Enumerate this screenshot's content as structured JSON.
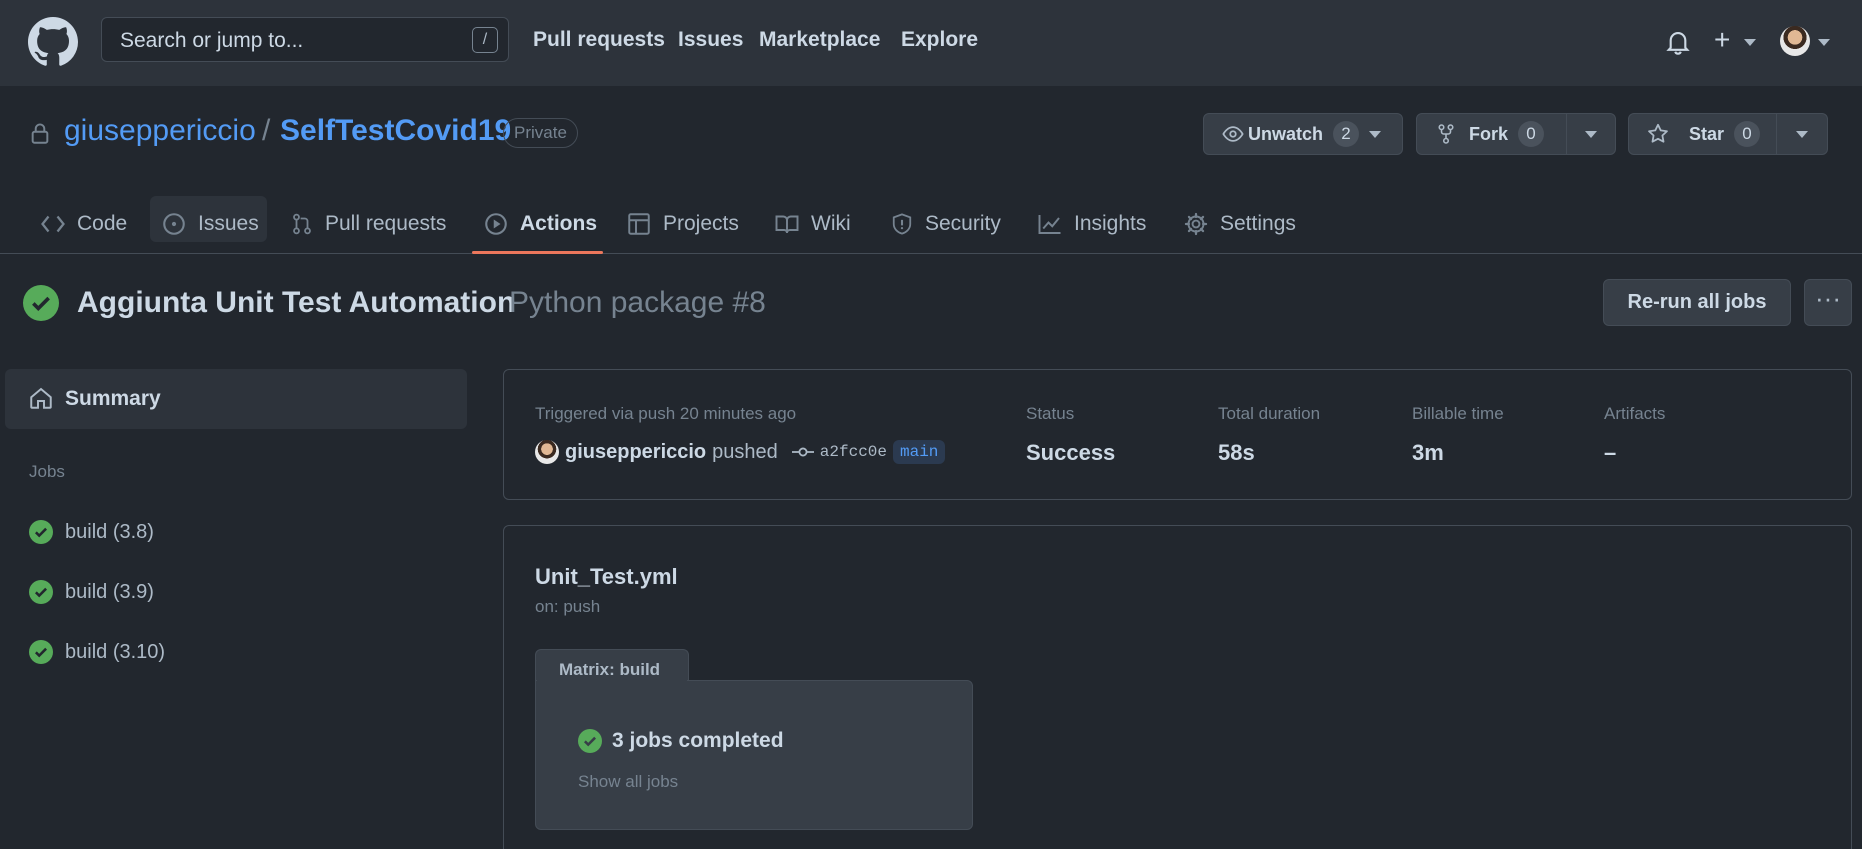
{
  "header": {
    "search_placeholder": "Search or jump to...",
    "search_shortcut": "/",
    "nav": [
      "Pull requests",
      "Issues",
      "Marketplace",
      "Explore"
    ],
    "plus": "+"
  },
  "repo": {
    "owner": "giuseppericcio",
    "separator": "/",
    "name": "SelfTestCovid19",
    "visibility": "Private",
    "watch": {
      "label": "Unwatch",
      "count": "2"
    },
    "fork": {
      "label": "Fork",
      "count": "0"
    },
    "star": {
      "label": "Star",
      "count": "0"
    }
  },
  "tabs": [
    {
      "label": "Code",
      "icon": "code-icon"
    },
    {
      "label": "Issues",
      "icon": "issue-icon"
    },
    {
      "label": "Pull requests",
      "icon": "pull-request-icon"
    },
    {
      "label": "Actions",
      "icon": "play-icon",
      "active": true
    },
    {
      "label": "Projects",
      "icon": "table-icon"
    },
    {
      "label": "Wiki",
      "icon": "book-icon"
    },
    {
      "label": "Security",
      "icon": "shield-icon"
    },
    {
      "label": "Insights",
      "icon": "graph-icon"
    },
    {
      "label": "Settings",
      "icon": "gear-icon"
    }
  ],
  "run": {
    "title": "Aggiunta Unit Test Automation",
    "subtitle": "Python package #8",
    "rerun_label": "Re-run all jobs",
    "more_label": "···"
  },
  "sidebar": {
    "summary": "Summary",
    "jobs_heading": "Jobs",
    "jobs": [
      "build (3.8)",
      "build (3.9)",
      "build (3.10)"
    ]
  },
  "summary_card": {
    "triggered": "Triggered via push 20 minutes ago",
    "user": "giuseppericcio",
    "action": "pushed",
    "sha": "a2fcc0e",
    "branch": "main",
    "stats": [
      {
        "key": "Status",
        "value": "Success"
      },
      {
        "key": "Total duration",
        "value": "58s"
      },
      {
        "key": "Billable time",
        "value": "3m"
      },
      {
        "key": "Artifacts",
        "value": "–"
      }
    ]
  },
  "workflow": {
    "file": "Unit_Test.yml",
    "trigger": "on: push",
    "matrix_label": "Matrix: build",
    "completed": "3 jobs completed",
    "show_all": "Show all jobs"
  },
  "colors": {
    "success": "#57ab5a",
    "link": "#539bf5",
    "accent": "#ec775c",
    "background": "#22272e"
  }
}
